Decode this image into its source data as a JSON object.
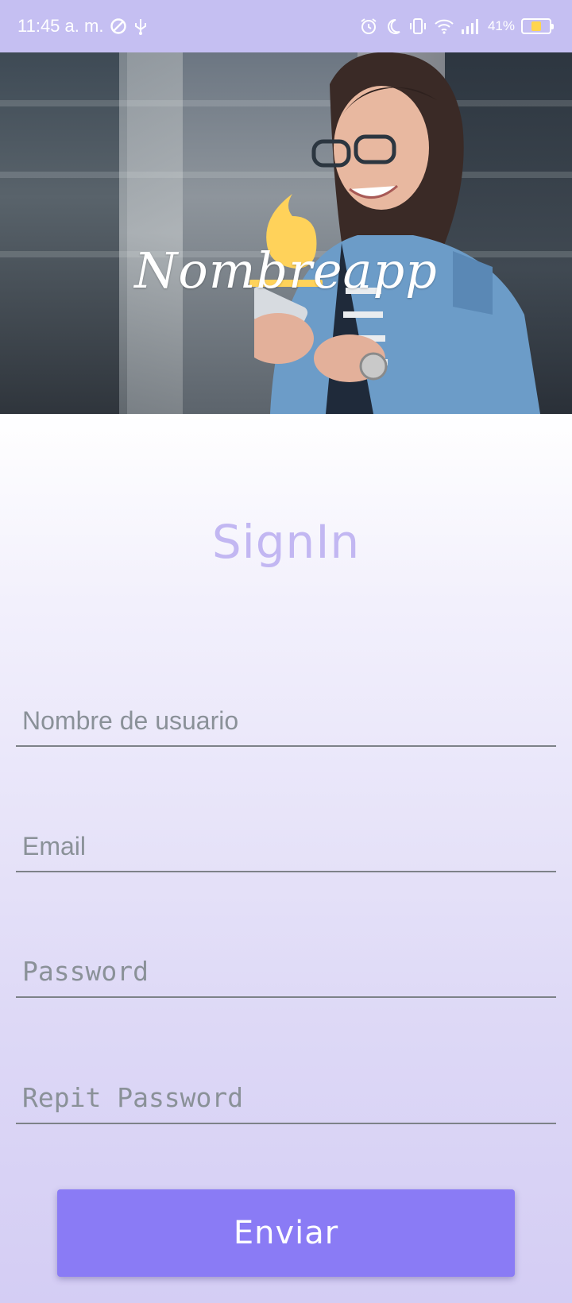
{
  "status_bar": {
    "time": "11:45 a. m.",
    "battery": "41%",
    "battery_level": 0.41,
    "icons": [
      "do-not-disturb-icon",
      "usb-icon",
      "alarm-icon",
      "moon-icon",
      "vibrate-icon",
      "wifi-icon",
      "signal-icon",
      "battery-icon"
    ]
  },
  "hero": {
    "app_name": "Nombreapp",
    "logo_icon": "flame-logo-icon"
  },
  "form": {
    "title": "SignIn",
    "username_placeholder": "Nombre de usuario",
    "email_placeholder": "Email",
    "password_placeholder": "Password",
    "repeat_password_placeholder": "Repit Password",
    "submit_label": "Enviar"
  },
  "colors": {
    "status_bar": "#c5bff2",
    "title": "#c2b7f2",
    "button": "#8a7bf5",
    "logo": "#ffd25a"
  }
}
